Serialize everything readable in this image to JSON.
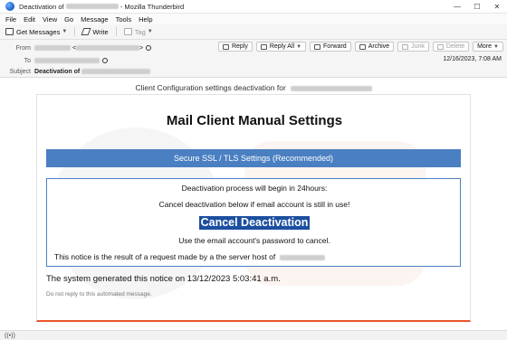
{
  "window": {
    "title_prefix": "Deactivation of",
    "title_suffix": "- Mozilla Thunderbird",
    "controls": [
      "—",
      "☐",
      "✕"
    ]
  },
  "menu": [
    "File",
    "Edit",
    "View",
    "Go",
    "Message",
    "Tools",
    "Help"
  ],
  "toolbar": {
    "get_messages": "Get Messages",
    "write": "Write",
    "tag": "Tag"
  },
  "header": {
    "from_label": "From",
    "to_label": "To",
    "subject_label": "Subject",
    "subject_prefix": "Deactivation of",
    "date": "12/16/2023, 7:08 AM",
    "actions": {
      "reply": "Reply",
      "reply_all": "Reply All",
      "forward": "Forward",
      "archive": "Archive",
      "junk": "Junk",
      "delete": "Delete",
      "more": "More"
    }
  },
  "email": {
    "config_line": "Client Configuration settings deactivation for",
    "title": "Mail Client Manual Settings",
    "secure_bar": "Secure  SSL / TLS Settings (Recommended)",
    "line1": "Deactivation process will begin in 24hours:",
    "line2": "Cancel deactivation below if email account is still in use!",
    "cancel_link": "Cancel Deactivation",
    "line4": "Use the email account's password to cancel.",
    "line5": "This notice is the result of a request made by a the server host of",
    "generated": "The system generated this notice on 13/12/2023 5:03:41 a.m.",
    "no_reply": "Do not reply to this automated message."
  },
  "colors": {
    "secure_bar": "#4a7fc1",
    "cancel_link_bg": "#1d4fa0",
    "card_accent": "#e8552c"
  }
}
